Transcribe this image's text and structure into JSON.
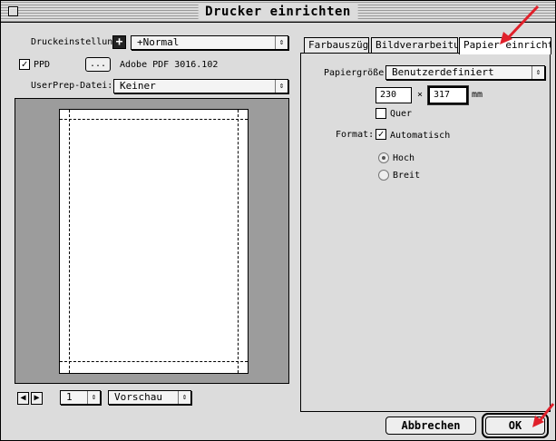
{
  "window": {
    "title": "Drucker einrichten"
  },
  "left": {
    "druckeinstellung_label": "Druckeinstellung:",
    "druckeinstellung_value": "+Normal",
    "ppd_label": "PPD",
    "ppd_checked": true,
    "ppd_button": "...",
    "ppd_value": "Adobe PDF 3016.102",
    "userprep_label": "UserPrep-Datei:",
    "userprep_value": "Keiner",
    "page_value": "1",
    "view_value": "Vorschau"
  },
  "tabs": [
    {
      "label": "Farbauszüge"
    },
    {
      "label": "Bildverarbeitung"
    },
    {
      "label": "Papier einrichten",
      "active": true
    }
  ],
  "paper": {
    "size_label": "Papiergröße:",
    "size_value": "Benutzerdefiniert",
    "width": "230",
    "times": "×",
    "height": "317",
    "unit": "mm",
    "quer_label": "Quer",
    "quer_checked": false,
    "format_label": "Format:",
    "auto_label": "Automatisch",
    "auto_checked": true,
    "hoch_label": "Hoch",
    "breit_label": "Breit"
  },
  "buttons": {
    "cancel": "Abbrechen",
    "ok": "OK"
  },
  "colors": {
    "arrow": "#e0202a"
  }
}
